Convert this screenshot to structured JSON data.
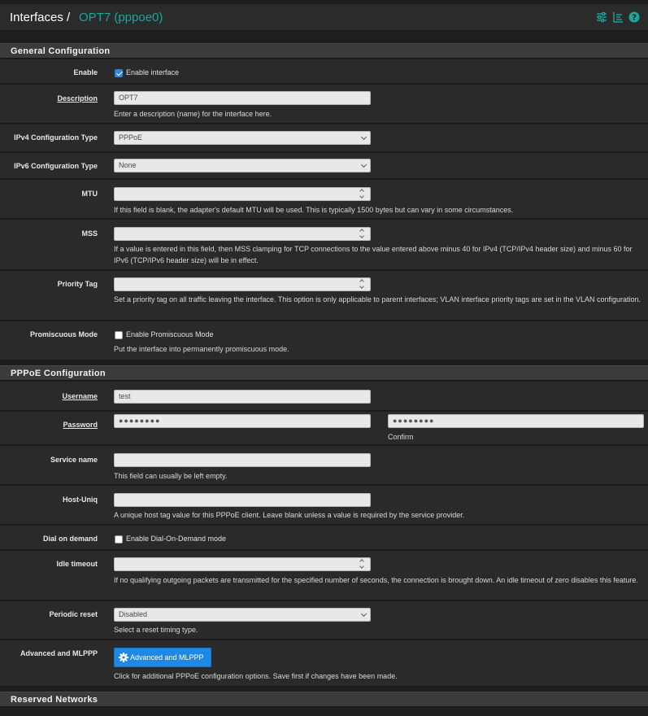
{
  "header": {
    "breadcrumb_main": "Interfaces /",
    "breadcrumb_sub": "OPT7 (pppoe0)",
    "icons": [
      "sliders-icon",
      "list-icon",
      "help-icon"
    ]
  },
  "general": {
    "title": "General Configuration",
    "enable": {
      "label": "Enable",
      "checkbox_label": "Enable interface",
      "checked": true
    },
    "description": {
      "label": "Description",
      "value": "OPT7",
      "help": "Enter a description (name) for the interface here."
    },
    "ipv4": {
      "label": "IPv4 Configuration Type",
      "value": "PPPoE"
    },
    "ipv6": {
      "label": "IPv6 Configuration Type",
      "value": "None"
    },
    "mtu": {
      "label": "MTU",
      "value": "",
      "help": "If this field is blank, the adapter's default MTU will be used. This is typically 1500 bytes but can vary in some circumstances."
    },
    "mss": {
      "label": "MSS",
      "value": "",
      "help": "If a value is entered in this field, then MSS clamping for TCP connections to the value entered above minus 40 for IPv4 (TCP/IPv4 header size) and minus 60 for IPv6 (TCP/IPv6 header size) will be in effect."
    },
    "priority": {
      "label": "Priority Tag",
      "value": "",
      "help": "Set a priority tag on all traffic leaving the interface. This option is only applicable to parent interfaces; VLAN interface priority tags are set in the VLAN configuration."
    },
    "promisc": {
      "label": "Promiscuous Mode",
      "checkbox_label": "Enable Promiscuous Mode",
      "checked": false,
      "help": "Put the interface into permanently promiscuous mode."
    }
  },
  "pppoe": {
    "title": "PPPoE Configuration",
    "username": {
      "label": "Username",
      "value": "test"
    },
    "password": {
      "label": "Password",
      "value": "●●●●●●●●",
      "confirm_value": "●●●●●●●●",
      "confirm_label": "Confirm"
    },
    "service": {
      "label": "Service name",
      "value": "",
      "help": "This field can usually be left empty."
    },
    "hostuniq": {
      "label": "Host-Uniq",
      "value": "",
      "help": "A unique host tag value for this PPPoE client. Leave blank unless a value is required by the service provider."
    },
    "dial": {
      "label": "Dial on demand",
      "checkbox_label": "Enable Dial-On-Demand mode",
      "checked": false
    },
    "idle": {
      "label": "Idle timeout",
      "value": "",
      "help": "If no qualifying outgoing packets are transmitted for the specified number of seconds, the connection is brought down. An idle timeout of zero disables this feature."
    },
    "reset": {
      "label": "Periodic reset",
      "value": "Disabled",
      "help": "Select a reset timing type."
    },
    "advanced": {
      "label": "Advanced and MLPPP",
      "button_label": "Advanced and MLPPP",
      "help": "Click for additional PPPoE configuration options. Save first if changes have been made."
    }
  },
  "reserved": {
    "title": "Reserved Networks"
  },
  "colors": {
    "accent": "#18a99a",
    "button": "#1e88e5",
    "checkbox": "#2f86d8"
  }
}
